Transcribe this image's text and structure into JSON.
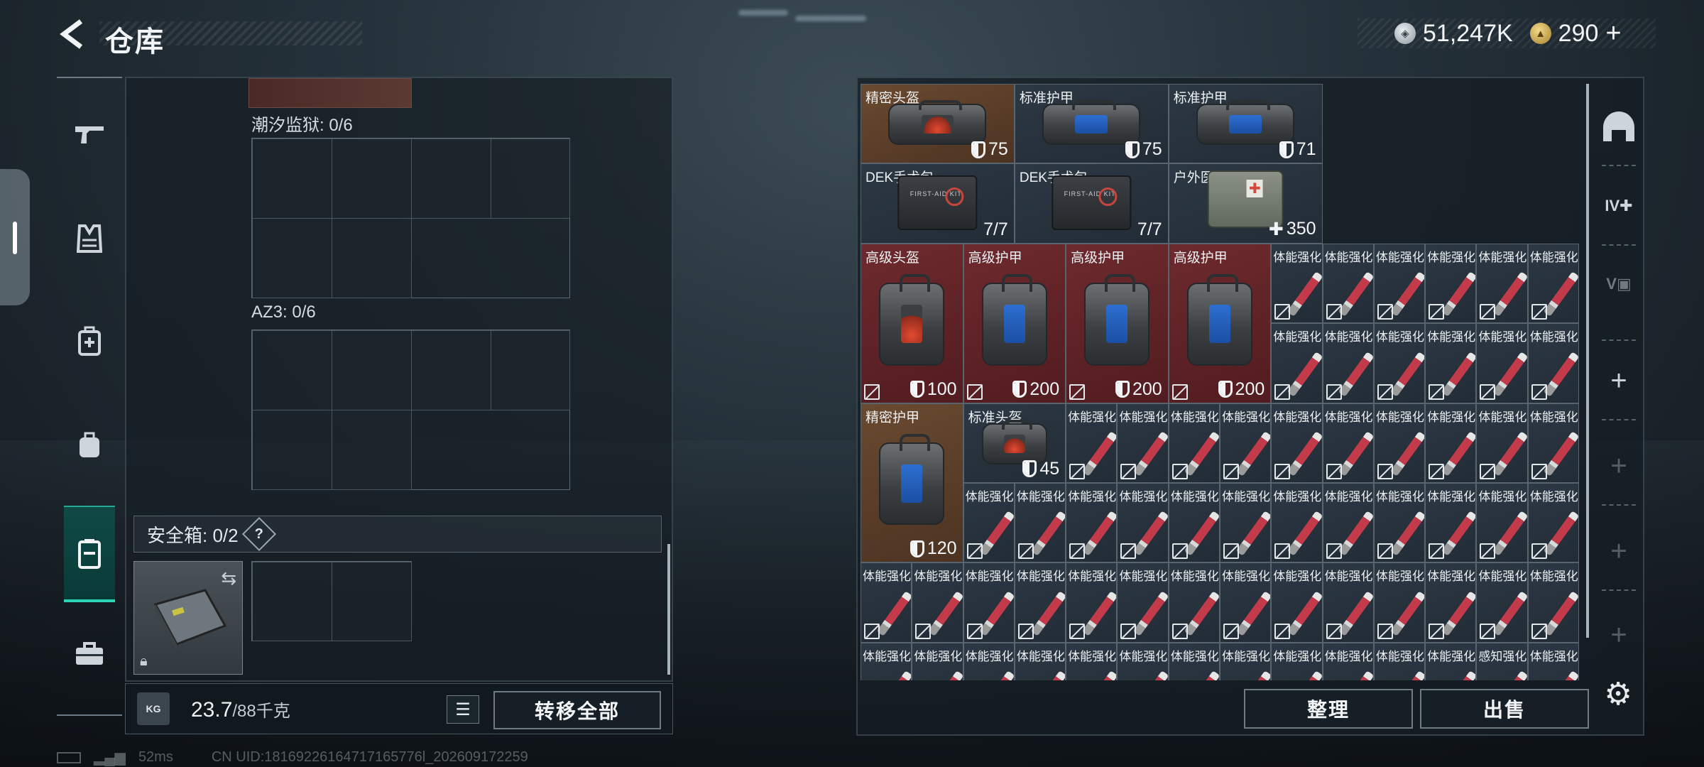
{
  "header": {
    "title": "仓库",
    "silver_value": "51,247K",
    "gold_value": "290",
    "gold_add": "+"
  },
  "left_panel": {
    "section_tide": "潮汐监狱: 0/6",
    "section_az3": "AZ3: 0/6",
    "safe_label": "安全箱: 0/2",
    "safe_help": "?",
    "weight_current": "23.7",
    "weight_max": "/88千克",
    "weight_icon": "KG",
    "transfer_all": "转移全部"
  },
  "inventory": [
    {
      "name": "精密头盔",
      "value": "75",
      "value_type": "armor",
      "color": "brown",
      "art": "helmet"
    },
    {
      "name": "标准护甲",
      "value": "75",
      "value_type": "armor",
      "color": "grey",
      "art": "vest"
    },
    {
      "name": "标准护甲",
      "value": "71",
      "value_type": "armor",
      "color": "grey",
      "art": "vest"
    },
    {
      "name": "DEK手术包",
      "value": "7/7",
      "value_type": "count",
      "color": "grey",
      "art": "kit"
    },
    {
      "name": "DEK手术包",
      "value": "7/7",
      "value_type": "count",
      "color": "grey",
      "art": "kit"
    },
    {
      "name": "户外医疗箱",
      "value": "350",
      "value_type": "heal",
      "color": "grey",
      "art": "medbag"
    },
    {
      "name": "高级头盔",
      "value": "100",
      "value_type": "armor",
      "color": "red",
      "art": "helmet"
    },
    {
      "name": "高级护甲",
      "value": "200",
      "value_type": "armor",
      "color": "red",
      "art": "vest"
    },
    {
      "name": "高级护甲",
      "value": "200",
      "value_type": "armor",
      "color": "red",
      "art": "vest"
    },
    {
      "name": "高级护甲",
      "value": "200",
      "value_type": "armor",
      "color": "red",
      "art": "vest"
    },
    {
      "name": "精密护甲",
      "value": "120",
      "value_type": "armor",
      "color": "brown",
      "art": "vest"
    },
    {
      "name": "标准头盔",
      "value": "45",
      "value_type": "armor",
      "color": "grey",
      "art": "helmet"
    }
  ],
  "syringe_label": "体能强化剂",
  "syringe_last_label": "感知强化剂",
  "actions": {
    "sort": "整理",
    "sell": "出售"
  },
  "status": {
    "ping": "52ms",
    "uid": "CN UID:18169226164717165776l_202609172259"
  }
}
